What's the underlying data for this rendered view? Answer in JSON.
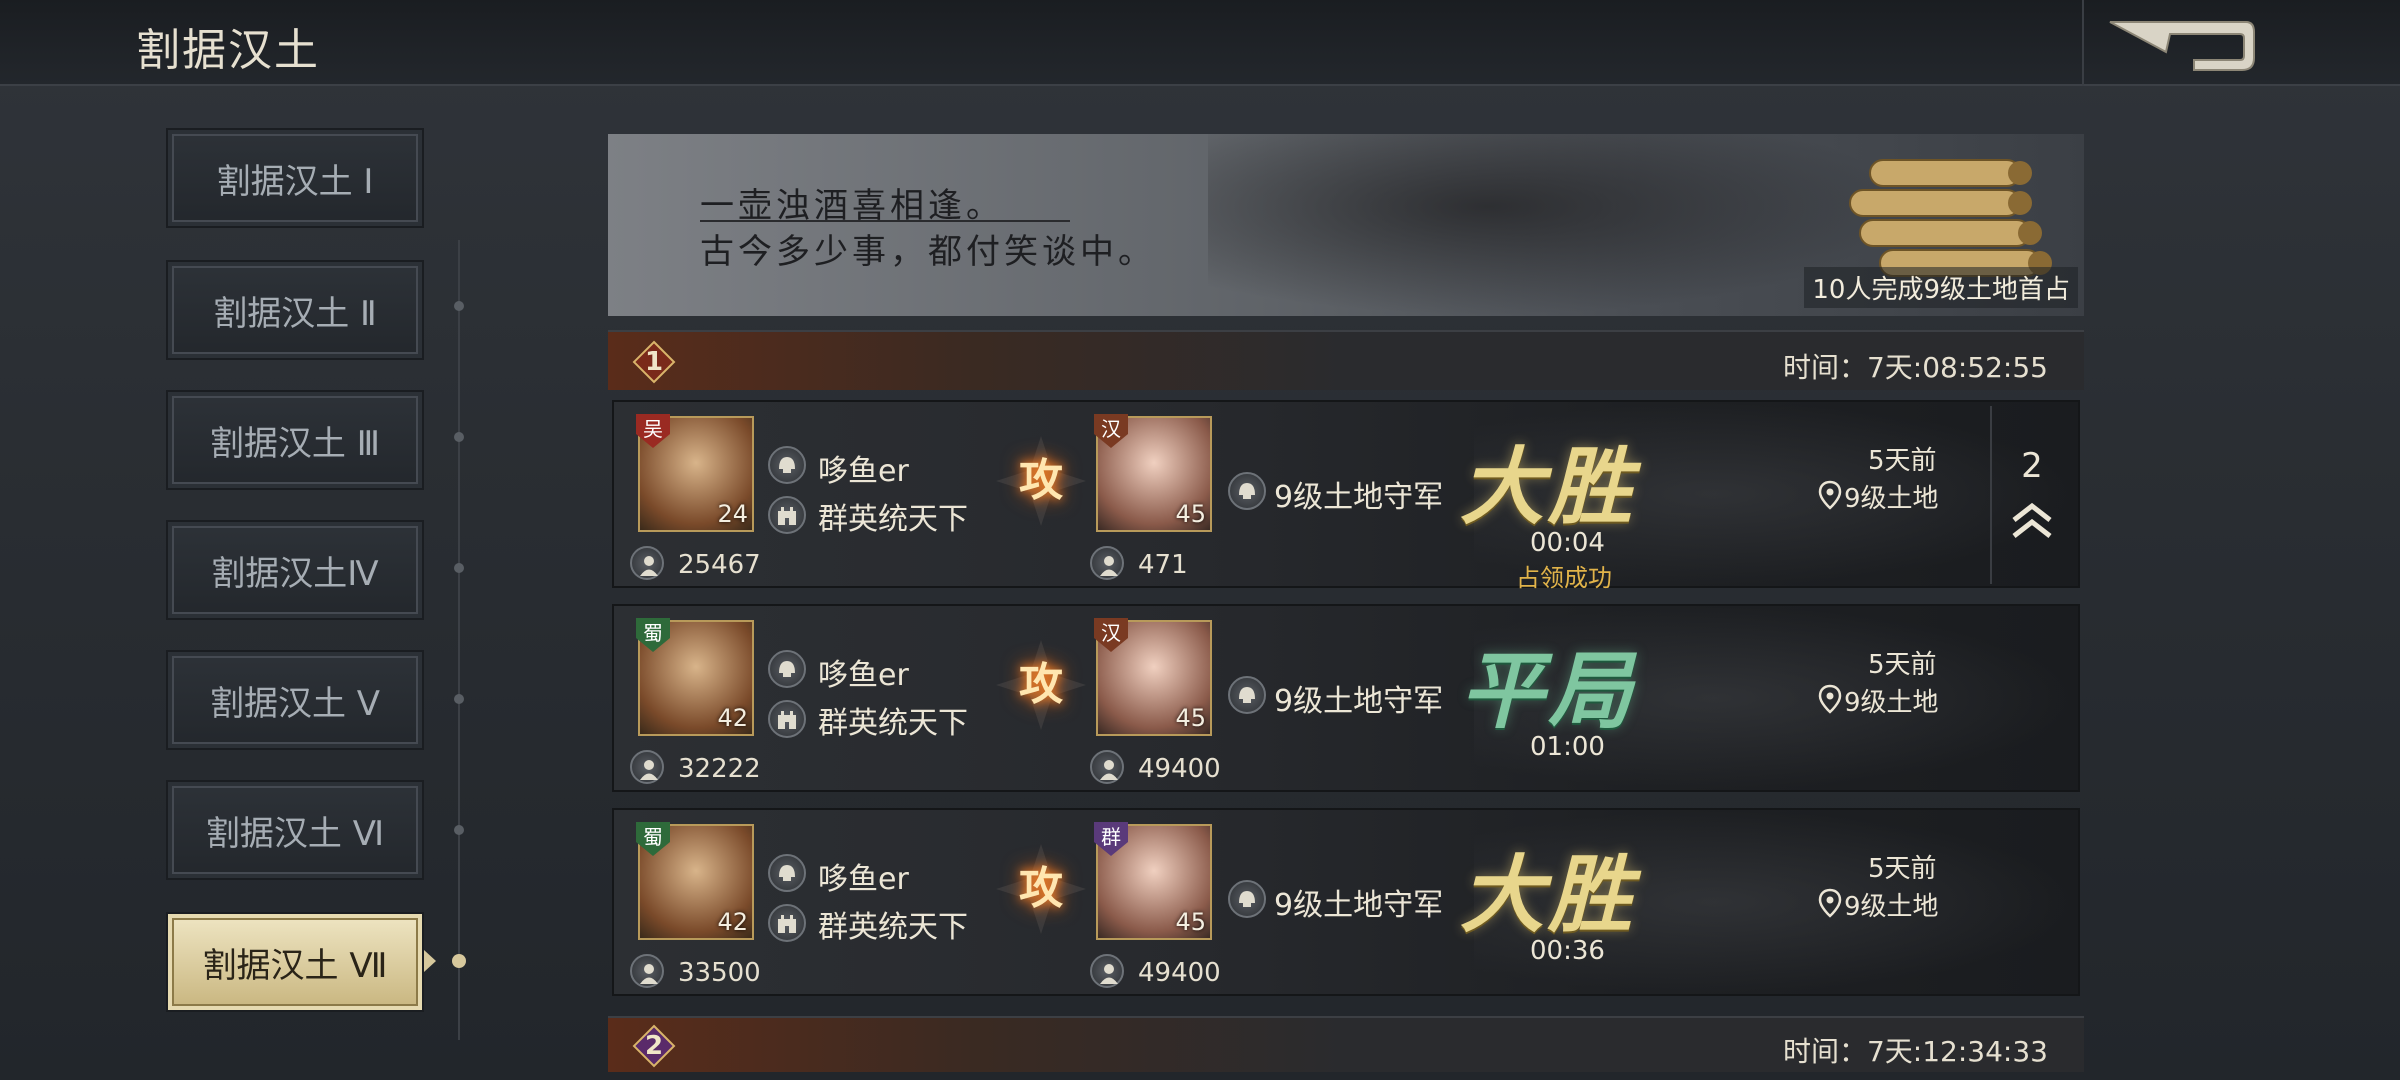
{
  "header": {
    "title": "割据汉土"
  },
  "sidebar": {
    "items": [
      {
        "label": "割据汉土 Ⅰ"
      },
      {
        "label": "割据汉土 Ⅱ"
      },
      {
        "label": "割据汉土 Ⅲ"
      },
      {
        "label": "割据汉土Ⅳ"
      },
      {
        "label": "割据汉土 Ⅴ"
      },
      {
        "label": "割据汉土 Ⅵ"
      },
      {
        "label": "割据汉土 Ⅶ"
      }
    ],
    "active_index": 6
  },
  "banner": {
    "line1": "一壶浊酒喜相逢。",
    "line2": "古今多少事，都付笑谈中。",
    "caption": "10人完成9级土地首占"
  },
  "sections": [
    {
      "number": "1",
      "time": "时间：7天:08:52:55"
    },
    {
      "number": "2",
      "time": "时间：7天:12:34:33"
    }
  ],
  "battles": [
    {
      "attacker": {
        "faction": "吴",
        "level": "24",
        "player": "哆鱼er",
        "alliance": "群英统天下",
        "power": "25467",
        "faction_color": "#9a2a22"
      },
      "defender": {
        "faction": "汉",
        "level": "45",
        "name": "9级土地守军",
        "power": "471",
        "faction_color": "#7a3a22"
      },
      "attack_label": "攻",
      "result": "大胜",
      "result_type": "win",
      "duration": "00:04",
      "status": "占领成功",
      "ago": "5天前",
      "location": "9级土地"
    },
    {
      "attacker": {
        "faction": "蜀",
        "level": "42",
        "player": "哆鱼er",
        "alliance": "群英统天下",
        "power": "32222",
        "faction_color": "#2e6a3a"
      },
      "defender": {
        "faction": "汉",
        "level": "45",
        "name": "9级土地守军",
        "power": "49400",
        "faction_color": "#7a3a22"
      },
      "attack_label": "攻",
      "result": "平局",
      "result_type": "draw",
      "duration": "01:00",
      "status": "",
      "ago": "5天前",
      "location": "9级土地"
    },
    {
      "attacker": {
        "faction": "蜀",
        "level": "42",
        "player": "哆鱼er",
        "alliance": "群英统天下",
        "power": "33500",
        "faction_color": "#2e6a3a"
      },
      "defender": {
        "faction": "群",
        "level": "45",
        "name": "9级土地守军",
        "power": "49400",
        "faction_color": "#5a3a7a"
      },
      "attack_label": "攻",
      "result": "大胜",
      "result_type": "win",
      "duration": "00:36",
      "status": "",
      "ago": "5天前",
      "location": "9级土地"
    }
  ],
  "side_counter": {
    "count": "2"
  }
}
